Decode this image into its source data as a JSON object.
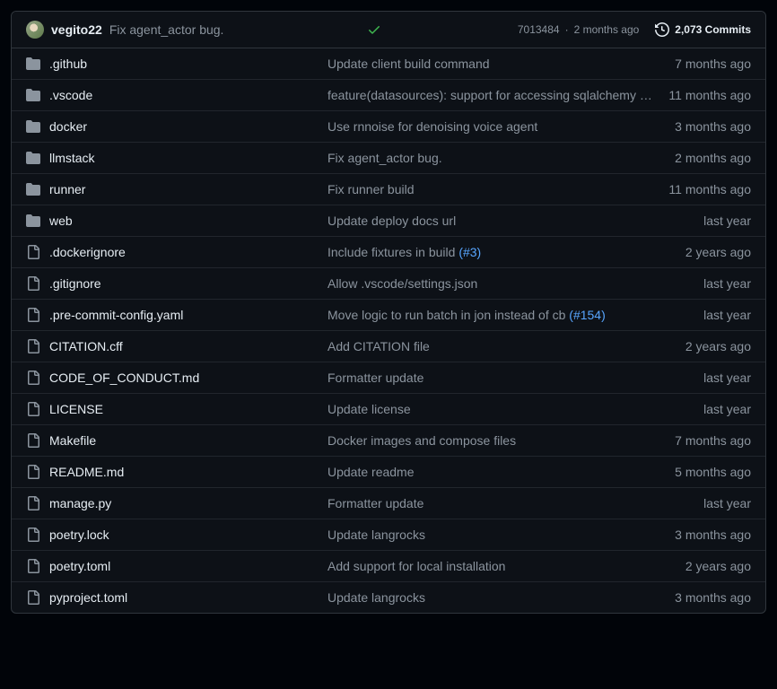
{
  "header": {
    "author": "vegito22",
    "commit_message": "Fix agent_actor bug.",
    "commit_hash": "7013484",
    "commit_age": "2 months ago",
    "commits_count": "2,073 Commits"
  },
  "files": [
    {
      "type": "dir",
      "name": ".github",
      "msg": "Update client build command",
      "pr": null,
      "age": "7 months ago"
    },
    {
      "type": "dir",
      "name": ".vscode",
      "msg": "feature(datasources): support for accessing sqlalchemy provi…",
      "pr": null,
      "age": "11 months ago"
    },
    {
      "type": "dir",
      "name": "docker",
      "msg": "Use rnnoise for denoising voice agent",
      "pr": null,
      "age": "3 months ago"
    },
    {
      "type": "dir",
      "name": "llmstack",
      "msg": "Fix agent_actor bug.",
      "pr": null,
      "age": "2 months ago"
    },
    {
      "type": "dir",
      "name": "runner",
      "msg": "Fix runner build",
      "pr": null,
      "age": "11 months ago"
    },
    {
      "type": "dir",
      "name": "web",
      "msg": "Update deploy docs url",
      "pr": null,
      "age": "last year"
    },
    {
      "type": "file",
      "name": ".dockerignore",
      "msg": "Include fixtures in build ",
      "pr": "(#3)",
      "age": "2 years ago"
    },
    {
      "type": "file",
      "name": ".gitignore",
      "msg": "Allow .vscode/settings.json",
      "pr": null,
      "age": "last year"
    },
    {
      "type": "file",
      "name": ".pre-commit-config.yaml",
      "msg": "Move logic to run batch in jon instead of cb ",
      "pr": "(#154)",
      "age": "last year"
    },
    {
      "type": "file",
      "name": "CITATION.cff",
      "msg": "Add CITATION file",
      "pr": null,
      "age": "2 years ago"
    },
    {
      "type": "file",
      "name": "CODE_OF_CONDUCT.md",
      "msg": "Formatter update",
      "pr": null,
      "age": "last year"
    },
    {
      "type": "file",
      "name": "LICENSE",
      "msg": "Update license",
      "pr": null,
      "age": "last year"
    },
    {
      "type": "file",
      "name": "Makefile",
      "msg": "Docker images and compose files",
      "pr": null,
      "age": "7 months ago"
    },
    {
      "type": "file",
      "name": "README.md",
      "msg": "Update readme",
      "pr": null,
      "age": "5 months ago"
    },
    {
      "type": "file",
      "name": "manage.py",
      "msg": "Formatter update",
      "pr": null,
      "age": "last year"
    },
    {
      "type": "file",
      "name": "poetry.lock",
      "msg": "Update langrocks",
      "pr": null,
      "age": "3 months ago"
    },
    {
      "type": "file",
      "name": "poetry.toml",
      "msg": "Add support for local installation",
      "pr": null,
      "age": "2 years ago"
    },
    {
      "type": "file",
      "name": "pyproject.toml",
      "msg": "Update langrocks",
      "pr": null,
      "age": "3 months ago"
    }
  ]
}
